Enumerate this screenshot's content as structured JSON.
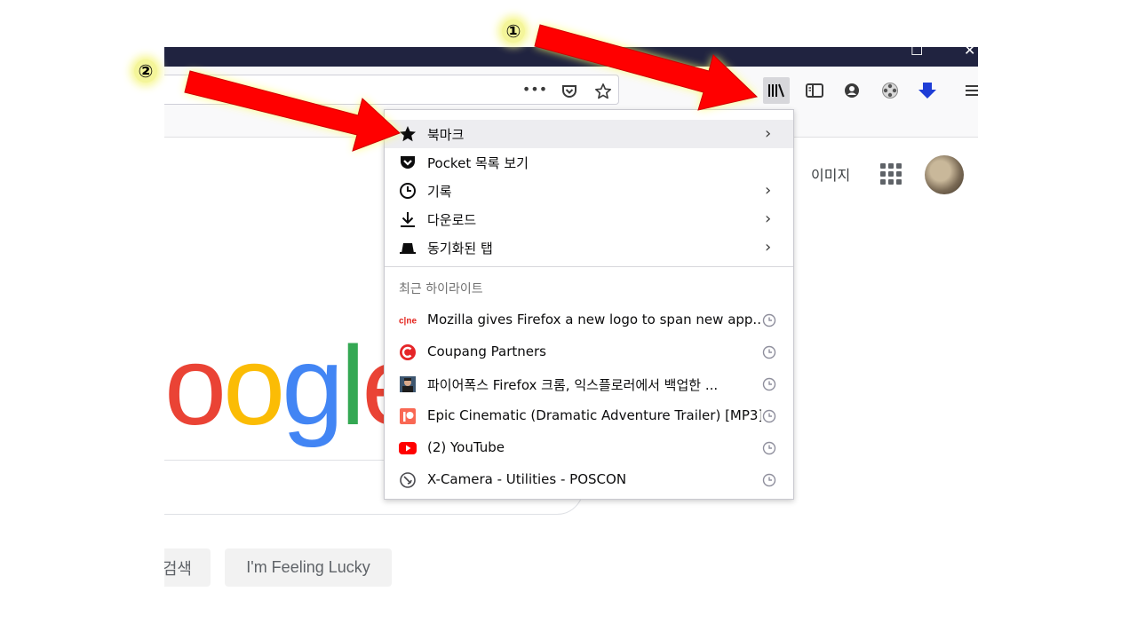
{
  "toolbar": {
    "page_actions_label": "•••"
  },
  "google": {
    "logo_letters": [
      {
        "char": "o",
        "color": "#EA4335"
      },
      {
        "char": "o",
        "color": "#FBBC05"
      },
      {
        "char": "g",
        "color": "#4285F4"
      },
      {
        "char": "l",
        "color": "#34A853"
      },
      {
        "char": "e",
        "color": "#EA4335"
      }
    ],
    "images_link": "이미지",
    "search_button": "검색",
    "lucky_button": "I'm Feeling Lucky"
  },
  "menu": {
    "items": [
      {
        "label": "북마크",
        "icon": "star-icon",
        "has_submenu": true
      },
      {
        "label": "Pocket 목록 보기",
        "icon": "pocket-icon",
        "has_submenu": false
      },
      {
        "label": "기록",
        "icon": "clock-icon",
        "has_submenu": true
      },
      {
        "label": "다운로드",
        "icon": "download-icon",
        "has_submenu": true
      },
      {
        "label": "동기화된 탭",
        "icon": "synced-tabs-icon",
        "has_submenu": true
      }
    ],
    "recent_title": "최근 하이라이트",
    "highlights": [
      {
        "label": "Mozilla gives Firefox a new logo to span new app...",
        "icon": "cnet-icon"
      },
      {
        "label": "Coupang Partners",
        "icon": "coupang-icon"
      },
      {
        "label": "파이어폭스 Firefox 크롬, 익스플로러에서 백업한 ...",
        "icon": "blog-avatar-icon"
      },
      {
        "label": "Epic Cinematic (Dramatic Adventure Trailer) [MP3]...",
        "icon": "patreon-icon"
      },
      {
        "label": "(2) YouTube",
        "icon": "youtube-icon"
      },
      {
        "label": "X-Camera - Utilities - POSCON",
        "icon": "xcamera-icon"
      }
    ]
  },
  "annotations": {
    "marker_1": "①",
    "marker_2": "②",
    "arrow_color": "#FF0000",
    "glow_color": "#FFFF66"
  }
}
